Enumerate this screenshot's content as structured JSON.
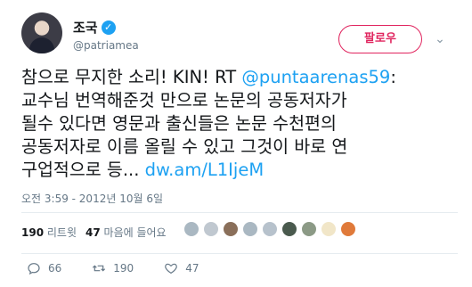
{
  "user": {
    "display_name": "조국",
    "handle": "@patriamea"
  },
  "follow_button": "팔로우",
  "tweet": {
    "line1_prefix": "참으로 무지한 소리! KIN! RT ",
    "mention": "@puntaarenas59",
    "line1_suffix": ":",
    "line2": "교수님 번역해준것 만으로 논문의 공동저자가",
    "line3": "될수 있다면 영문과 출신들은 논문 수천편의",
    "line4": "공동저자로 이름 올릴 수 있고 그것이 바로 연",
    "line5_prefix": "구업적으로 등... ",
    "link": "dw.am/L1IjeM"
  },
  "timestamp": "오전 3:59 - 2012년 10월 6일",
  "stats": {
    "retweets_count": "190",
    "retweets_label": "리트윗",
    "likes_count": "47",
    "likes_label": "마음에 들어요"
  },
  "likers": [
    "#aab8c2",
    "#c0c8d0",
    "#8a6f5a",
    "#aab8c2",
    "#b7c2cc",
    "#4a5a4e",
    "#8c9a86",
    "#f1e6c8",
    "#e07a3a"
  ],
  "actions": {
    "reply_count": "66",
    "retweet_count": "190",
    "like_count": "47"
  },
  "colors": {
    "accent": "#1da1f2",
    "follow": "#e0245e",
    "muted": "#657786"
  }
}
